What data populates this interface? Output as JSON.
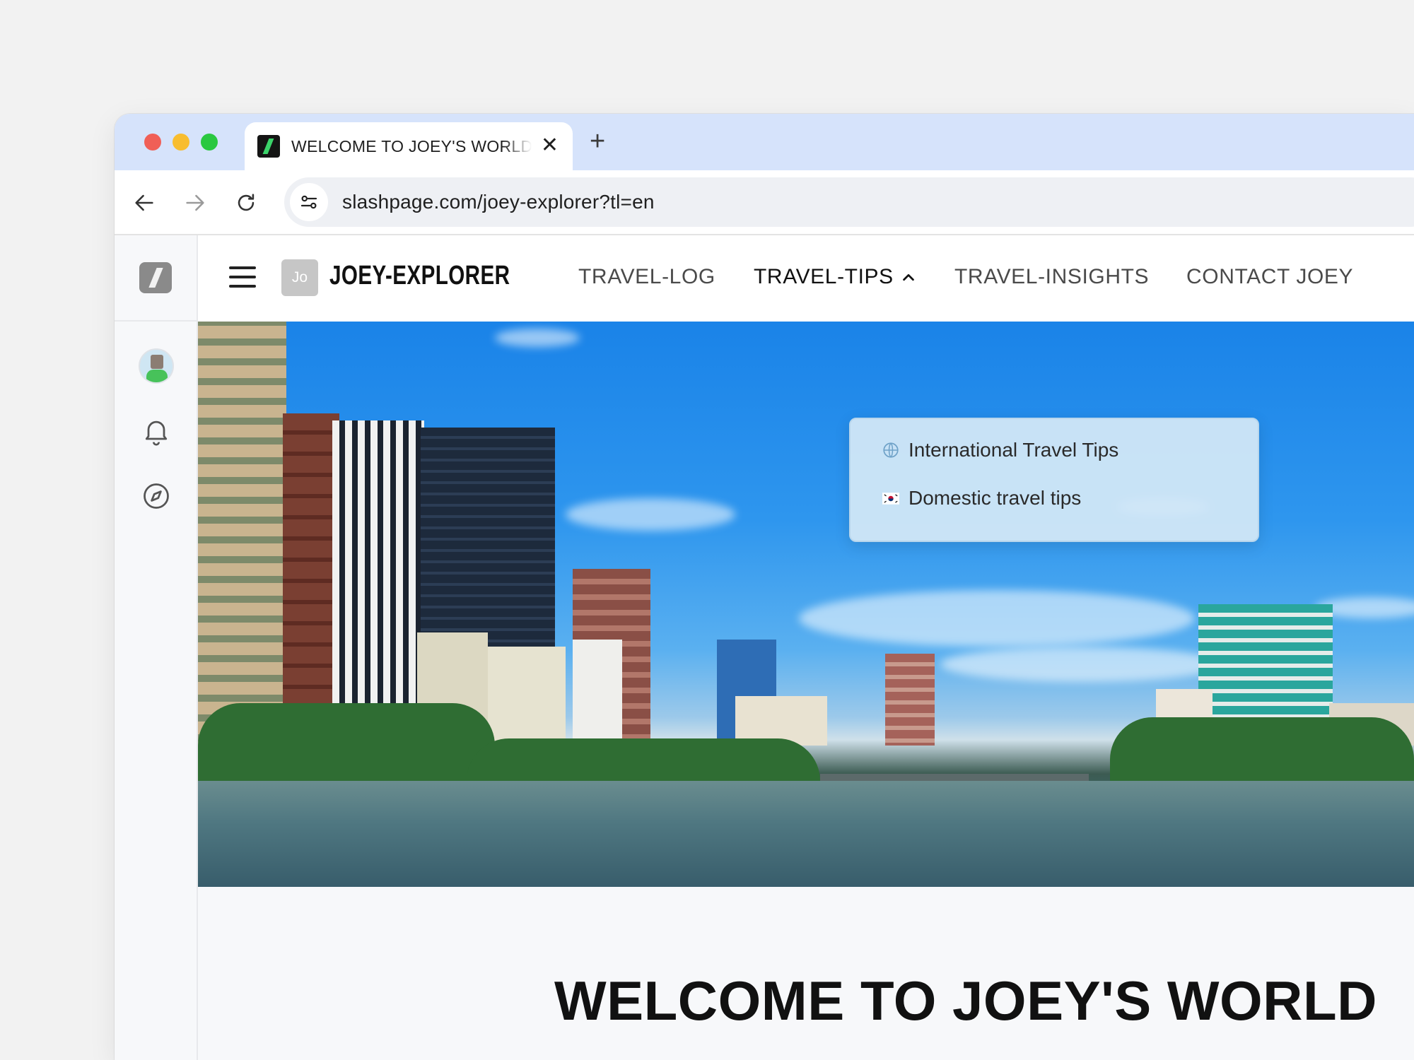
{
  "browser": {
    "tab_title": "WELCOME TO JOEY'S WORLD",
    "tab_close": "✕",
    "new_tab": "+",
    "url": "slashpage.com/joey-explorer?tl=en",
    "icons": {
      "back": "arrow-left-icon",
      "forward": "arrow-right-icon",
      "reload": "reload-icon",
      "site_info": "tune-icon",
      "favicon": "slash-logo-icon"
    }
  },
  "rail": {
    "icons": [
      "slash-logo-icon",
      "avatar",
      "bell-icon",
      "compass-icon"
    ]
  },
  "site": {
    "logo_text": "Jo",
    "name": "JOEY-EXPLORER",
    "nav": [
      {
        "label": "TRAVEL-LOG"
      },
      {
        "label": "TRAVEL-TIPS",
        "expanded": true
      },
      {
        "label": "TRAVEL-INSIGHTS"
      },
      {
        "label": "CONTACT JOEY"
      }
    ],
    "dropdown": [
      {
        "label": "International Travel Tips",
        "icon": "globe-icon"
      },
      {
        "label": "Domestic travel tips",
        "icon": "korea-flag-icon"
      }
    ]
  },
  "hero": {
    "image": "city-river-skyline-photo"
  },
  "main": {
    "headline": "WELCOME TO JOEY'S WORLD"
  },
  "colors": {
    "tabstrip": "#d6e3fb",
    "accent_green": "#3bd36a",
    "dropdown_bg": "#d2e8f6"
  }
}
